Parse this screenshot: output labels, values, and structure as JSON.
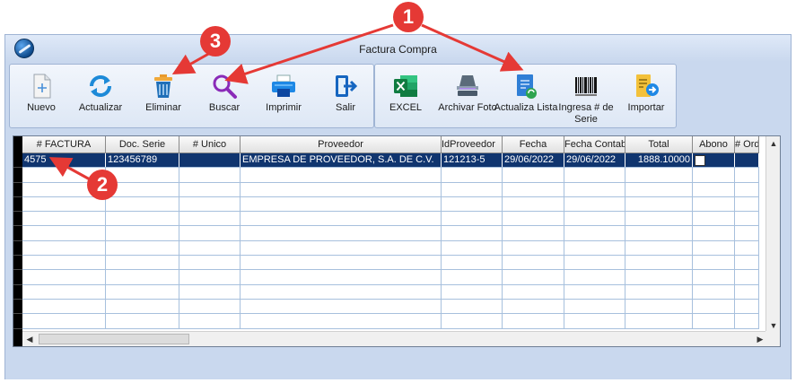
{
  "window": {
    "title": "Factura Compra"
  },
  "toolbar": {
    "group1": [
      {
        "label": "Nuevo",
        "icon": "new-document-icon"
      },
      {
        "label": "Actualizar",
        "icon": "refresh-icon"
      },
      {
        "label": "Eliminar",
        "icon": "trash-icon"
      },
      {
        "label": "Buscar",
        "icon": "search-icon"
      },
      {
        "label": "Imprimir",
        "icon": "printer-icon"
      },
      {
        "label": "Salir",
        "icon": "exit-icon"
      }
    ],
    "group2": [
      {
        "label": "EXCEL",
        "icon": "excel-icon"
      },
      {
        "label": "Archivar Foto",
        "icon": "scanner-icon"
      },
      {
        "label": "Actualiza Lista",
        "icon": "update-list-icon"
      },
      {
        "label": "Ingresa # de Serie",
        "icon": "barcode-icon"
      },
      {
        "label": "Importar",
        "icon": "import-icon"
      }
    ]
  },
  "grid": {
    "columns": [
      "# FACTURA",
      "Doc. Serie",
      "# Unico",
      "Proveedor",
      "IdProveedor",
      "Fecha",
      "Fecha Contable",
      "Total",
      "Abono",
      "# Orden"
    ],
    "rows": [
      {
        "factura": "4575",
        "doc_serie": "123456789",
        "unico": "",
        "proveedor": "EMPRESA DE PROVEEDOR, S.A. DE C.V.",
        "id_proveedor": "121213-5",
        "fecha": "29/06/2022",
        "fecha_contable": "29/06/2022",
        "total": "1888.10000",
        "abono": false,
        "orden": ""
      }
    ]
  },
  "annotations": [
    {
      "number": "1"
    },
    {
      "number": "2"
    },
    {
      "number": "3"
    }
  ],
  "colors": {
    "accent": "#e53935",
    "selected_row": "#10356f",
    "window_bg": "#c9d8ee"
  }
}
